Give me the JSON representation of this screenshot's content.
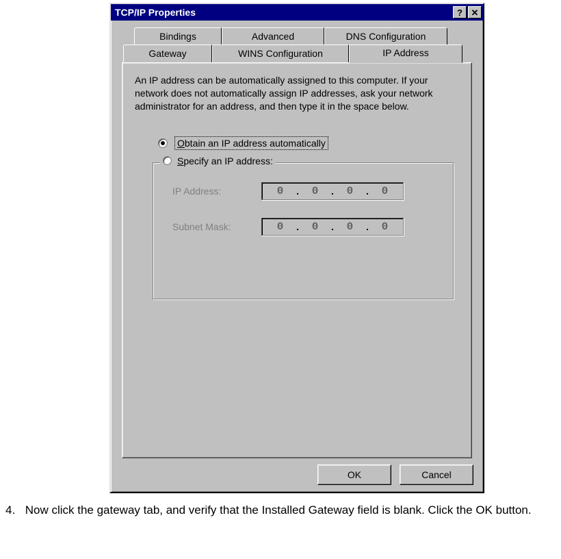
{
  "window": {
    "title": "TCP/IP Properties",
    "help_btn": "?",
    "close_btn": "✕"
  },
  "tabs": {
    "row1": {
      "bindings": "Bindings",
      "advanced": "Advanced",
      "dns": "DNS Configuration"
    },
    "row2": {
      "gateway": "Gateway",
      "wins": "WINS Configuration",
      "ip": "IP Address"
    }
  },
  "content": {
    "description": "An IP address can be automatically assigned to this computer. If your network does not automatically assign IP addresses, ask your network administrator for an address, and then type it in the space below.",
    "opt_auto": "Obtain an IP address automatically",
    "opt_specify": "Specify an IP address:",
    "ip_label": "IP Address:",
    "mask_label": "Subnet Mask:",
    "ip_value": {
      "a": "0",
      "b": "0",
      "c": "0",
      "d": "0"
    },
    "mask_value": {
      "a": "0",
      "b": "0",
      "c": "0",
      "d": "0"
    }
  },
  "buttons": {
    "ok": "OK",
    "cancel": "Cancel"
  },
  "caption": {
    "num": "4.",
    "text": "Now click the gateway tab, and verify that the Installed Gateway field is blank. Click the OK button."
  }
}
